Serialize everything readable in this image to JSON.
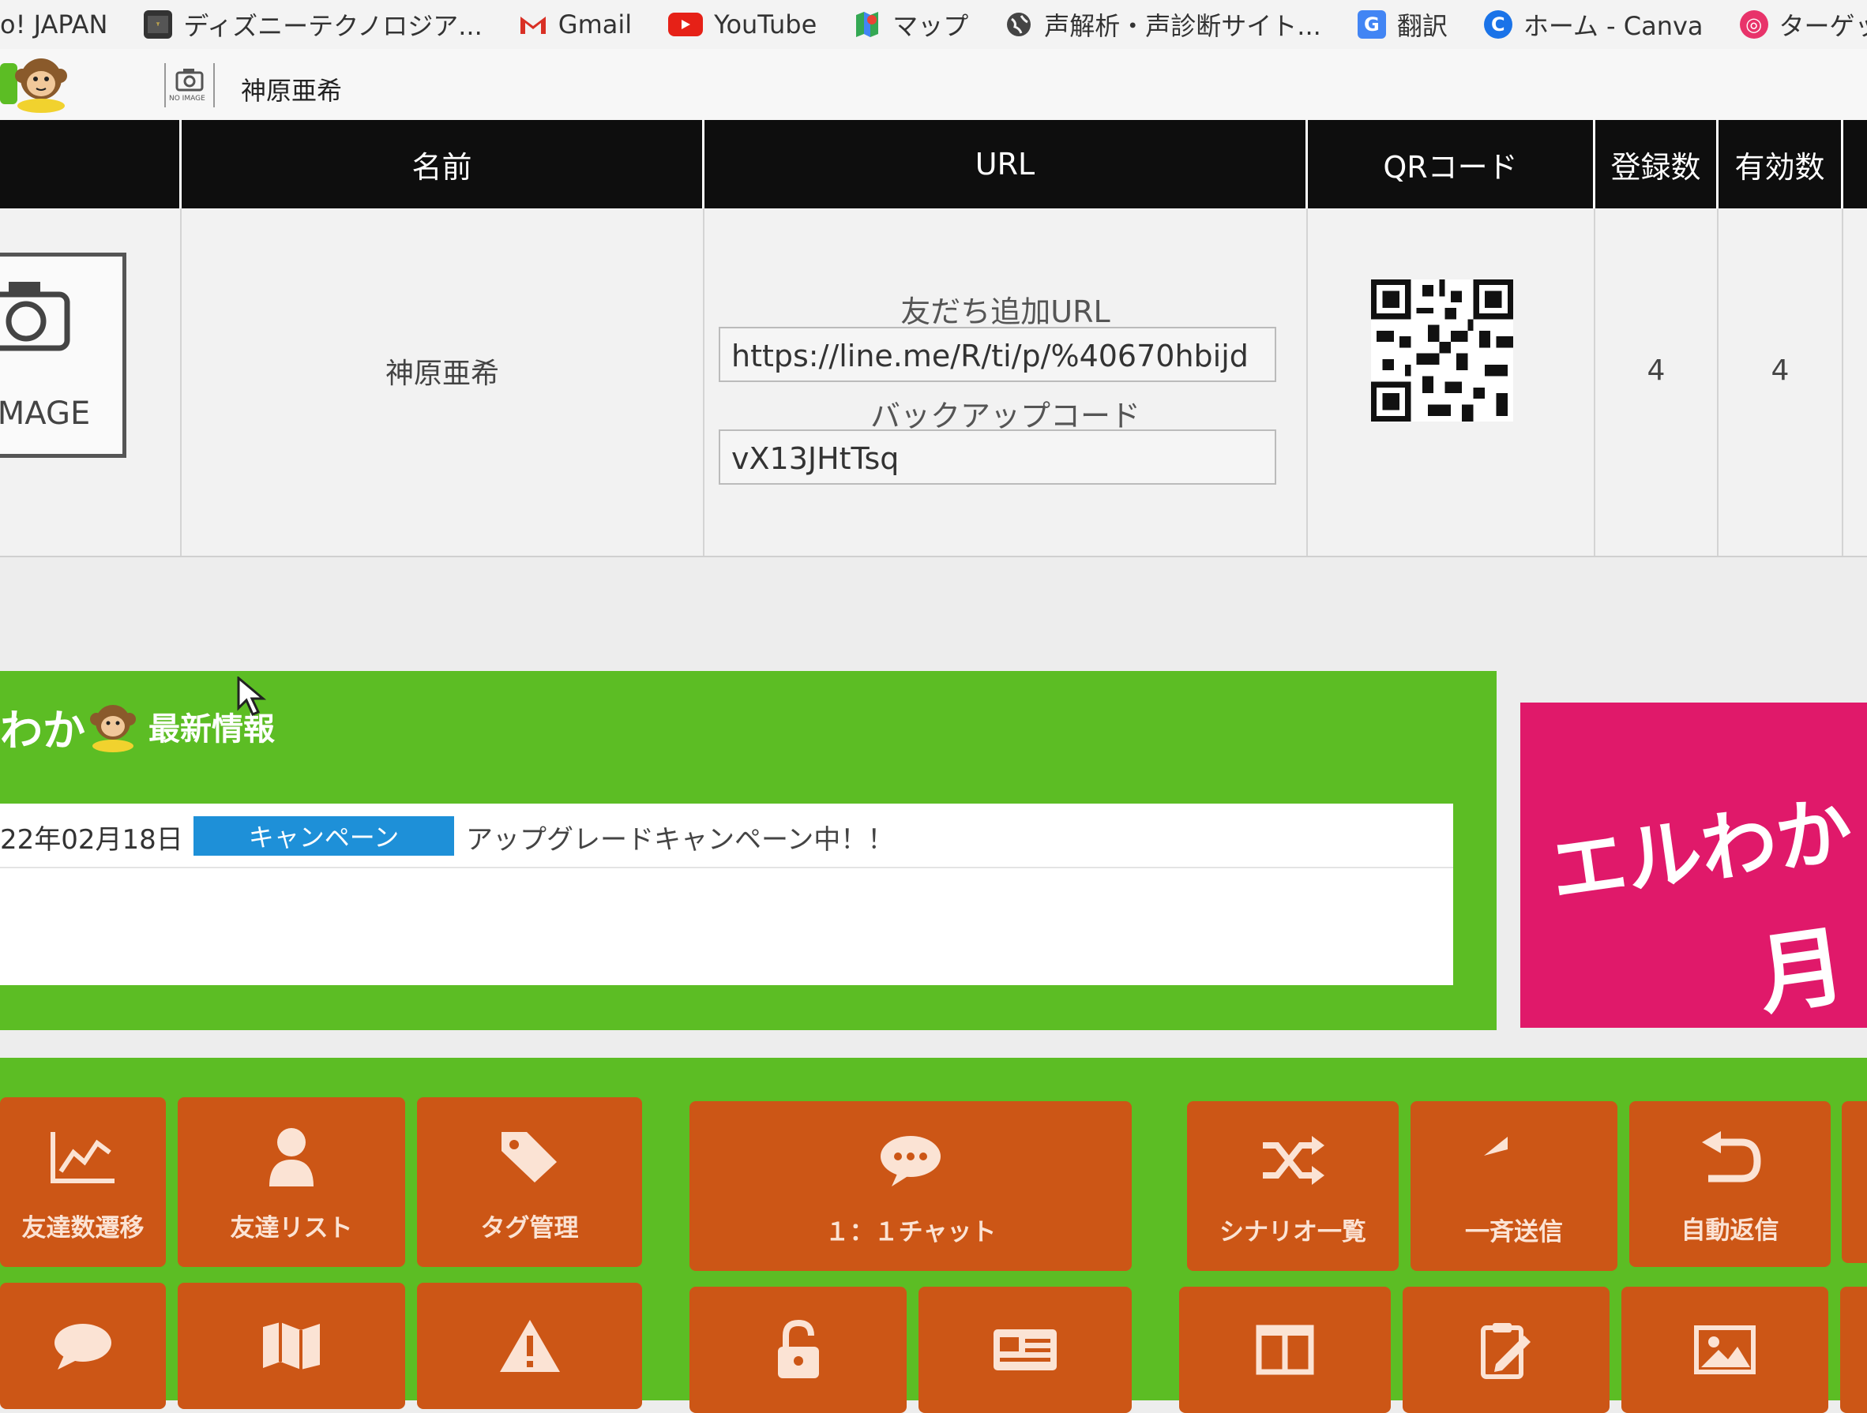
{
  "bookmarks": [
    {
      "label": "o! JAPAN",
      "icon": "yahoo-icon"
    },
    {
      "label": "ディズニーテクノロジア...",
      "icon": "disney-icon"
    },
    {
      "label": "Gmail",
      "icon": "gmail-icon"
    },
    {
      "label": "YouTube",
      "icon": "youtube-icon"
    },
    {
      "label": "マップ",
      "icon": "maps-icon"
    },
    {
      "label": "声解析・声診断サイト...",
      "icon": "globe-icon"
    },
    {
      "label": "翻訳",
      "icon": "translate-icon"
    },
    {
      "label": "ホーム - Canva",
      "icon": "canva-icon"
    },
    {
      "label": "ターゲットリサーチ - Mi...",
      "icon": "target-icon"
    }
  ],
  "account": {
    "name": "神原亜希",
    "noimage_small": "NO IMAGE"
  },
  "table": {
    "headers": {
      "name": "名前",
      "url": "URL",
      "qr": "QRコード",
      "registered": "登録数",
      "valid": "有効数"
    },
    "row": {
      "image_label": "IMAGE",
      "name": "神原亜希",
      "friend_url_label": "友だち追加URL",
      "friend_url": "https://line.me/R/ti/p/%40670hbijd",
      "backup_label": "バックアップコード",
      "backup_code": "vX13JHtTsq",
      "registered": "4",
      "valid": "4"
    }
  },
  "news": {
    "brand": "わか",
    "heading": "最新情報",
    "items": [
      {
        "date": "22年02月18日",
        "tag": "キャンペーン",
        "text": "アップグレードキャンペーン中！！"
      }
    ],
    "colors": {
      "bg": "#5cbd24",
      "tag": "#1e90d8"
    }
  },
  "promo": {
    "line1": "エルわか",
    "line2": "月"
  },
  "menu": {
    "row1": [
      {
        "label": "友達数遷移",
        "icon": "chart-line-icon"
      },
      {
        "label": "友達リスト",
        "icon": "person-icon"
      },
      {
        "label": "タグ管理",
        "icon": "tag-icon"
      },
      {
        "label": "１：１チャット",
        "icon": "chat-bubble-icon"
      },
      {
        "label": "シナリオ一覧",
        "icon": "shuffle-icon"
      },
      {
        "label": "一斉送信",
        "icon": "reply-icon"
      },
      {
        "label": "自動返信",
        "icon": "return-icon"
      }
    ],
    "row2_icons": [
      "speech-bubble-icon",
      "map-icon",
      "warning-icon",
      "unlock-icon",
      "card-icon",
      "columns-icon",
      "clipboard-edit-icon",
      "image-icon"
    ],
    "colors": {
      "tile": "#cc5616",
      "bg": "#5cbd24"
    }
  }
}
